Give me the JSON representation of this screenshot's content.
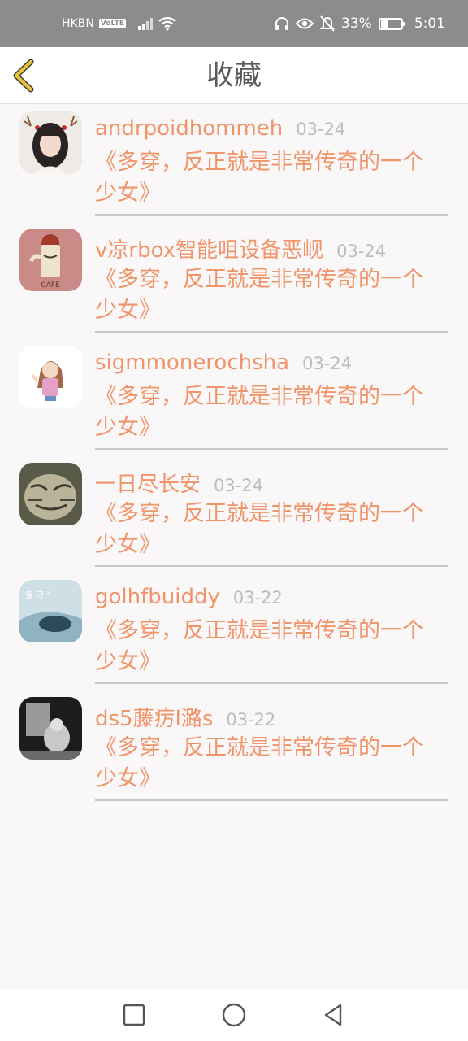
{
  "status_bar": {
    "carrier": "HKBN",
    "volte": "VoLTE",
    "battery": "33%",
    "battery_level": 0.33,
    "time": "5:01"
  },
  "header": {
    "title": "收藏",
    "back_icon": "chevron-left-icon"
  },
  "colors": {
    "accent": "#f0956a",
    "back_icon": "#e8c23a",
    "date": "#bdbdbd",
    "status_bar": "#8c8c8c"
  },
  "favorites": [
    {
      "name": "andrpoidhommeh",
      "date": "03-24",
      "message": "《多穿，反正就是非常传奇的一个少女》"
    },
    {
      "name": "v凉rbox智能咀设备恶岘",
      "date": "03-24",
      "message": "《多穿，反正就是非常传奇的一个少女》"
    },
    {
      "name": "sigmmonerochsha",
      "date": "03-24",
      "message": "《多穿，反正就是非常传奇的一个少女》"
    },
    {
      "name": "一日尽长安",
      "date": "03-24",
      "message": "《多穿，反正就是非常传奇的一个少女》"
    },
    {
      "name": "golhfbuiddy",
      "date": "03-22",
      "message": "《多穿，反正就是非常传奇的一个少女》"
    },
    {
      "name": "ds5藤疠l潞s",
      "date": "03-22",
      "message": "《多穿，反正就是非常传奇的一个少女》"
    }
  ],
  "avatar_texts": {
    "cafe": "CAFÉ",
    "boat": "宝 刁 ²"
  },
  "nav": {
    "recents": "square-icon",
    "home": "circle-icon",
    "back": "triangle-back-icon"
  }
}
